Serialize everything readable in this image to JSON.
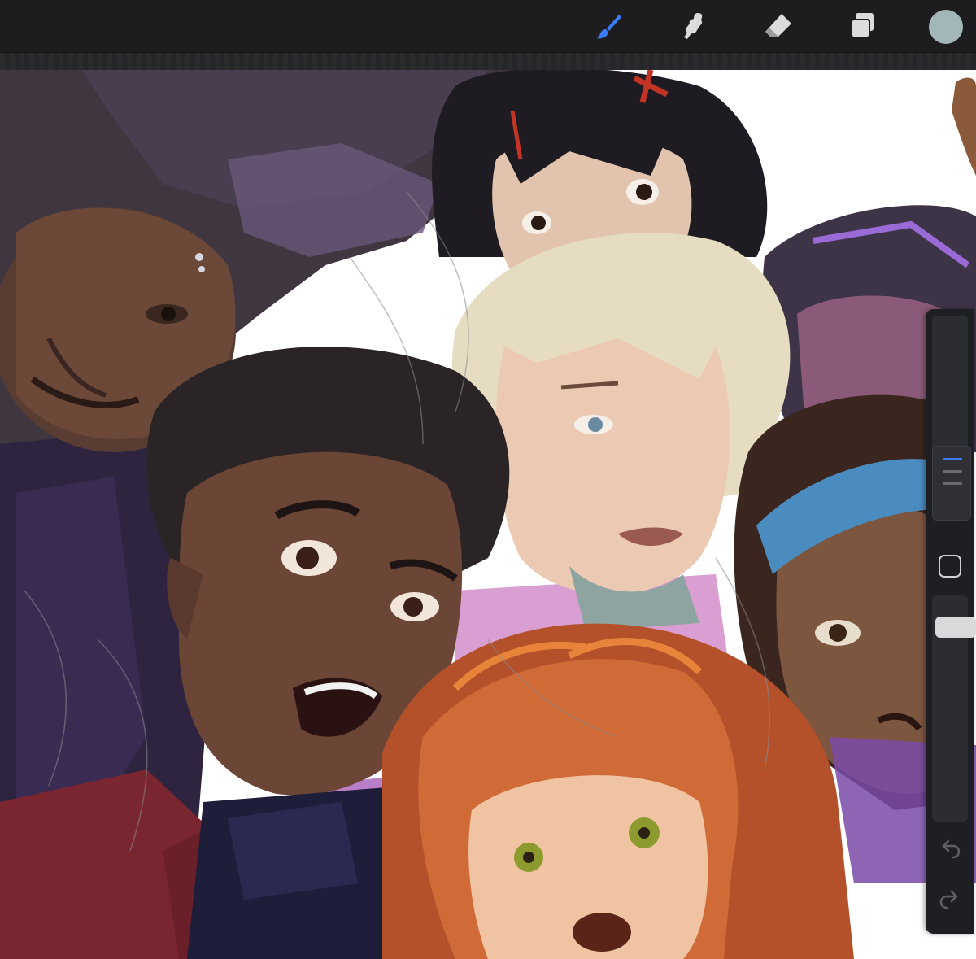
{
  "app": {
    "accent_color": "#3b7cf5",
    "current_color": "#a4b7b8"
  },
  "toolbar": {
    "tools": [
      {
        "name": "brush",
        "icon": "brush-icon",
        "active": true
      },
      {
        "name": "smudge",
        "icon": "smudge-icon",
        "active": false
      },
      {
        "name": "eraser",
        "icon": "eraser-icon",
        "active": false
      },
      {
        "name": "layers",
        "icon": "layers-icon",
        "active": false
      }
    ],
    "color_swatch_icon": "color-circle"
  },
  "sidebar": {
    "brush_size_icon": "size-slider",
    "modify_icon": "square-icon",
    "opacity_icon": "opacity-slider",
    "undo_icon": "undo-arrow-icon",
    "redo_icon": "redo-arrow-icon"
  },
  "canvas": {
    "content": "painting",
    "palette": {
      "dark_purple": "#3b2f45",
      "skin_dark": "#5a3d32",
      "skin_mid": "#8a5f4a",
      "skin_light": "#e8c9ad",
      "hair_blonde": "#e6dcc2",
      "hair_red": "#c0582a",
      "headband_blue": "#4a8cc0",
      "maroon": "#7a2630",
      "lavender": "#b87fc8",
      "pink": "#d99ed2"
    }
  }
}
